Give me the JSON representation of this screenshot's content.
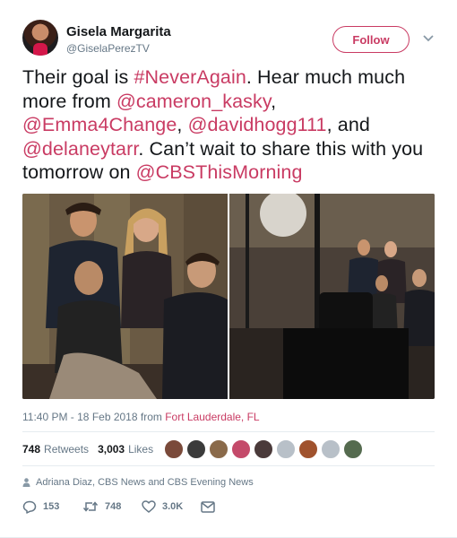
{
  "author": {
    "display_name": "Gisela Margarita",
    "handle": "@GiselaPerezTV"
  },
  "follow_button": "Follow",
  "tweet": {
    "parts": [
      {
        "text": "Their goal is ",
        "link": false
      },
      {
        "text": "#NeverAgain",
        "link": true
      },
      {
        "text": ". Hear much much more from ",
        "link": false
      },
      {
        "text": "@cameron_kasky",
        "link": true
      },
      {
        "text": ", ",
        "link": false
      },
      {
        "text": "@Emma4Change",
        "link": true
      },
      {
        "text": ", ",
        "link": false
      },
      {
        "text": "@davidhogg111",
        "link": true
      },
      {
        "text": ", and ",
        "link": false
      },
      {
        "text": "@delaneytarr",
        "link": true
      },
      {
        "text": ". Can’t wait to share this with you tomorrow on ",
        "link": false
      },
      {
        "text": "@CBSThisMorning",
        "link": true
      }
    ]
  },
  "meta": {
    "time": "11:40 PM - 18 Feb 2018 from ",
    "place": "Fort Lauderdale, FL"
  },
  "stats": {
    "retweets_count": "748",
    "retweets_label": "Retweets",
    "likes_count": "3,003",
    "likes_label": "Likes"
  },
  "likers_avatar_colors": [
    "#7a4a3a",
    "#3b3b3b",
    "#8a6a4a",
    "#c44a6a",
    "#4a3a3a",
    "#b8c0c8",
    "#a0522d",
    "#b8c0c8",
    "#556b4f"
  ],
  "context": "Adriana Diaz, CBS News and CBS Evening News",
  "actions": {
    "replies": "153",
    "retweets": "748",
    "likes": "3.0K"
  },
  "colors": {
    "accent": "#c93b63",
    "text": "#14171a",
    "muted": "#657786",
    "border": "#e6ecf0"
  }
}
